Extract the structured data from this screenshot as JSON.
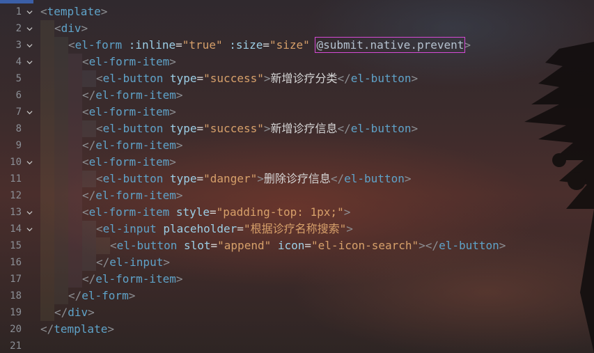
{
  "colors": {
    "tag": "#5fa3c9",
    "attr": "#9ccfe6",
    "string": "#d7a06a",
    "punctuation": "#8d8f93",
    "text": "#d6d6d6",
    "line_number": "#8b8f96",
    "highlight_box": "#d64ad6"
  },
  "lines": [
    {
      "n": "1",
      "tokens": [
        "<",
        "template",
        ">"
      ]
    },
    {
      "n": "2",
      "tokens": [
        "<",
        "div",
        ">"
      ]
    },
    {
      "n": "3",
      "tokens": [
        "<",
        "el-form",
        " :inline",
        "=",
        "\"true\"",
        " :size",
        "=",
        "\"size\"",
        " ",
        "@submit.native.prevent",
        ">"
      ]
    },
    {
      "n": "4",
      "tokens": [
        "<",
        "el-form-item",
        ">"
      ]
    },
    {
      "n": "5",
      "tokens": [
        "<",
        "el-button",
        " type",
        "=",
        "\"success\"",
        ">",
        "新增诊疗分类",
        "</",
        "el-button",
        ">"
      ]
    },
    {
      "n": "6",
      "tokens": [
        "</",
        "el-form-item",
        ">"
      ]
    },
    {
      "n": "7",
      "tokens": [
        "<",
        "el-form-item",
        ">"
      ]
    },
    {
      "n": "8",
      "tokens": [
        "<",
        "el-button",
        " type",
        "=",
        "\"success\"",
        ">",
        "新增诊疗信息",
        "</",
        "el-button",
        ">"
      ]
    },
    {
      "n": "9",
      "tokens": [
        "</",
        "el-form-item",
        ">"
      ]
    },
    {
      "n": "10",
      "tokens": [
        "<",
        "el-form-item",
        ">"
      ]
    },
    {
      "n": "11",
      "tokens": [
        "<",
        "el-button",
        " type",
        "=",
        "\"danger\"",
        ">",
        "删除诊疗信息",
        "</",
        "el-button",
        ">"
      ]
    },
    {
      "n": "12",
      "tokens": [
        "</",
        "el-form-item",
        ">"
      ]
    },
    {
      "n": "13",
      "tokens": [
        "<",
        "el-form-item",
        " style",
        "=",
        "\"padding-top: 1px;\"",
        ">"
      ]
    },
    {
      "n": "14",
      "tokens": [
        "<",
        "el-input",
        " placeholder",
        "=",
        "\"根据诊疗名称搜索\"",
        ">"
      ]
    },
    {
      "n": "15",
      "tokens": [
        "<",
        "el-button",
        " slot",
        "=",
        "\"append\"",
        " icon",
        "=",
        "\"el-icon-search\"",
        ">",
        "</",
        "el-button",
        ">"
      ]
    },
    {
      "n": "16",
      "tokens": [
        "</",
        "el-input",
        ">"
      ]
    },
    {
      "n": "17",
      "tokens": [
        "</",
        "el-form-item",
        ">"
      ]
    },
    {
      "n": "18",
      "tokens": [
        "</",
        "el-form",
        ">"
      ]
    },
    {
      "n": "19",
      "tokens": [
        "</",
        "div",
        ">"
      ]
    },
    {
      "n": "20",
      "tokens": [
        "</",
        "template",
        ">"
      ]
    },
    {
      "n": "21",
      "tokens": []
    }
  ]
}
